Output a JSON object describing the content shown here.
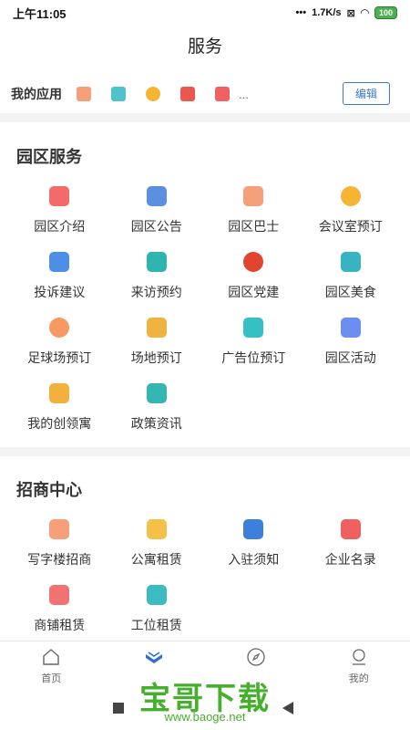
{
  "status": {
    "time": "上午11:05",
    "dots": "•••",
    "speed": "1.7K/s",
    "battery": "100"
  },
  "title": "服务",
  "my_apps": {
    "label": "我的应用",
    "icons": [
      {
        "name": "building-icon",
        "color": "#f5a07a"
      },
      {
        "name": "checkbox-icon",
        "color": "#4fc3c9"
      },
      {
        "name": "clock-icon",
        "color": "#f5b433"
      },
      {
        "name": "tools-icon",
        "color": "#e9574f"
      },
      {
        "name": "note-icon",
        "color": "#f06262"
      }
    ],
    "more": "...",
    "edit": "编辑"
  },
  "park_services": {
    "title": "园区服务",
    "items": [
      {
        "label": "园区介绍",
        "icon": "doc-icon",
        "color": "#f26a6a"
      },
      {
        "label": "园区公告",
        "icon": "newspaper-icon",
        "color": "#5b8fe0"
      },
      {
        "label": "园区巴士",
        "icon": "bus-icon",
        "color": "#f5a07a"
      },
      {
        "label": "会议室预订",
        "icon": "clock-icon",
        "color": "#f5b433"
      },
      {
        "label": "投诉建议",
        "icon": "mail-icon",
        "color": "#4d8fe4"
      },
      {
        "label": "来访预约",
        "icon": "people-icon",
        "color": "#2fb5b0"
      },
      {
        "label": "园区党建",
        "icon": "party-icon",
        "color": "#e2452f"
      },
      {
        "label": "园区美食",
        "icon": "utensils-icon",
        "color": "#37b3c2"
      },
      {
        "label": "足球场预订",
        "icon": "football-icon",
        "color": "#f59a63"
      },
      {
        "label": "场地预订",
        "icon": "venue-icon",
        "color": "#f0b340"
      },
      {
        "label": "广告位预订",
        "icon": "card-icon",
        "color": "#34c0c4"
      },
      {
        "label": "园区活动",
        "icon": "calendar-icon",
        "color": "#6a8ff0"
      },
      {
        "label": "我的创领寓",
        "icon": "house-icon",
        "color": "#f2b13c"
      },
      {
        "label": "政策资讯",
        "icon": "podium-icon",
        "color": "#34b6b3"
      }
    ]
  },
  "investment": {
    "title": "招商中心",
    "items": [
      {
        "label": "写字楼招商",
        "icon": "office-icon",
        "color": "#f5a07a"
      },
      {
        "label": "公寓租赁",
        "icon": "apartment-icon",
        "color": "#f5c04a"
      },
      {
        "label": "入驻须知",
        "icon": "flag-icon",
        "color": "#3f7fdc"
      },
      {
        "label": "企业名录",
        "icon": "list-icon",
        "color": "#ef6060"
      },
      {
        "label": "商铺租赁",
        "icon": "shop-icon",
        "color": "#f07272"
      },
      {
        "label": "工位租赁",
        "icon": "desk-icon",
        "color": "#3bbcc2"
      }
    ]
  },
  "tabs": [
    {
      "label": "首页",
      "icon": "home-icon",
      "active": false
    },
    {
      "label": "",
      "icon": "service-icon",
      "active": true
    },
    {
      "label": "",
      "icon": "compass-icon",
      "active": false
    },
    {
      "label": "我的",
      "icon": "profile-icon",
      "active": false
    }
  ],
  "watermark": {
    "big": "宝哥下载",
    "small": "www.baoge.net"
  }
}
